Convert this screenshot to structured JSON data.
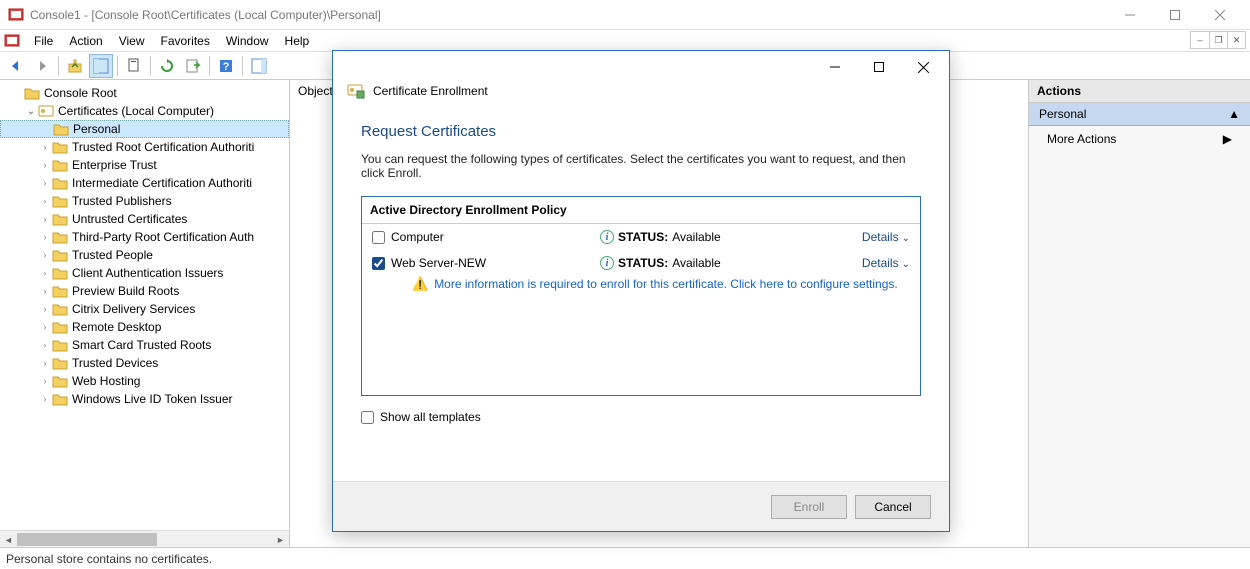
{
  "window": {
    "title": "Console1 - [Console Root\\Certificates (Local Computer)\\Personal]"
  },
  "menu": {
    "items": [
      "File",
      "Action",
      "View",
      "Favorites",
      "Window",
      "Help"
    ]
  },
  "tree": {
    "root": "Console Root",
    "cert_node": "Certificates (Local Computer)",
    "selected": "Personal",
    "children": [
      "Trusted Root Certification Authoriti",
      "Enterprise Trust",
      "Intermediate Certification Authoriti",
      "Trusted Publishers",
      "Untrusted Certificates",
      "Third-Party Root Certification Auth",
      "Trusted People",
      "Client Authentication Issuers",
      "Preview Build Roots",
      "Citrix Delivery Services",
      "Remote Desktop",
      "Smart Card Trusted Roots",
      "Trusted Devices",
      "Web Hosting",
      "Windows Live ID Token Issuer"
    ]
  },
  "center": {
    "column": "Object"
  },
  "actions": {
    "header": "Actions",
    "section": "Personal",
    "more": "More Actions"
  },
  "status": {
    "text": "Personal store contains no certificates."
  },
  "dialog": {
    "header": "Certificate Enrollment",
    "title": "Request Certificates",
    "intro": "You can request the following types of certificates. Select the certificates you want to request, and then click Enroll.",
    "policy_title": "Active Directory Enrollment Policy",
    "certs": [
      {
        "name": "Computer",
        "checked": false,
        "status_label": "STATUS:",
        "status_value": "Available",
        "details": "Details"
      },
      {
        "name": "Web Server-NEW",
        "checked": true,
        "status_label": "STATUS:",
        "status_value": "Available",
        "details": "Details"
      }
    ],
    "warn_link": "More information is required to enroll for this certificate. Click here to configure settings.",
    "show_all": "Show all templates",
    "btn_enroll": "Enroll",
    "btn_cancel": "Cancel"
  }
}
